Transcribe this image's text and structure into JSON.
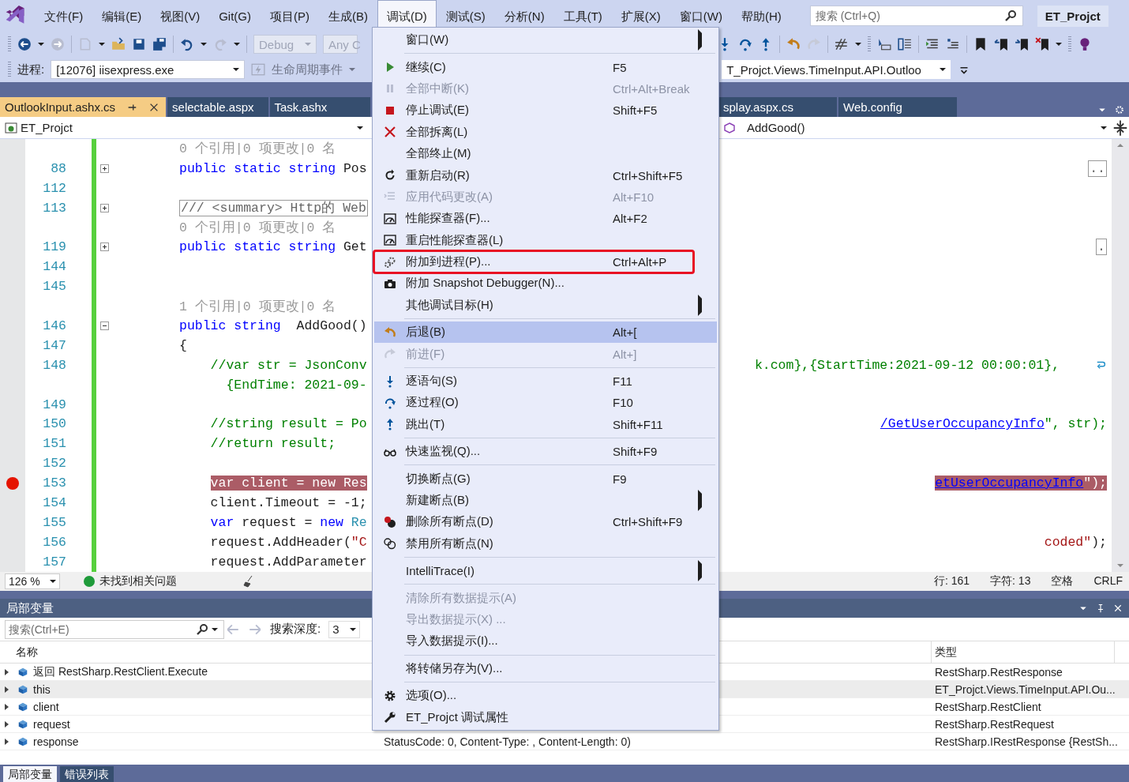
{
  "menubar": {
    "items": [
      {
        "label": "文件(F)",
        "selected": false
      },
      {
        "label": "编辑(E)",
        "selected": false
      },
      {
        "label": "视图(V)",
        "selected": false
      },
      {
        "label": "Git(G)",
        "selected": false
      },
      {
        "label": "项目(P)",
        "selected": false
      },
      {
        "label": "生成(B)",
        "selected": false
      },
      {
        "label": "调试(D)",
        "selected": true
      },
      {
        "label": "测试(S)",
        "selected": false
      },
      {
        "label": "分析(N)",
        "selected": false
      },
      {
        "label": "工具(T)",
        "selected": false
      },
      {
        "label": "扩展(X)",
        "selected": false
      },
      {
        "label": "窗口(W)",
        "selected": false
      },
      {
        "label": "帮助(H)",
        "selected": false
      }
    ],
    "search": {
      "placeholder": "搜索 (Ctrl+Q)"
    },
    "project": "ET_Projct"
  },
  "toolbar": {
    "configuration": "Debug",
    "platform": "Any C",
    "process_label": "进程:",
    "process": "[12076] iisexpress.exe",
    "lifecycle": "生命周期事件",
    "stack_frame": "T_Projct.Views.TimeInput.API.Outloo"
  },
  "doc_tabs": {
    "left": [
      {
        "label": "OutlookInput.ashx.cs",
        "selected": true
      },
      {
        "label": "selectable.aspx",
        "selected": false
      },
      {
        "label": "Task.ashx",
        "selected": false
      }
    ],
    "right": [
      {
        "label": "splay.aspx.cs",
        "selected": false
      },
      {
        "label": "Web.config",
        "selected": false
      }
    ]
  },
  "nav": {
    "project": "ET_Projct",
    "member": "AddGood()"
  },
  "editor": {
    "lines": [
      {
        "left": [
          {
            "text": "0 个引用|0 项更改|0 名",
            "kind": "lens"
          }
        ]
      },
      {
        "number": "88",
        "collapsed": true,
        "left": [
          {
            "text": "public static string ",
            "kind": "keyword"
          },
          {
            "text": "Pos",
            "kind": "plain"
          }
        ],
        "right": [
          {
            "text": "..",
            "kind": "collapsed"
          }
        ]
      },
      {
        "number": "112"
      },
      {
        "number": "113",
        "collapsed": true,
        "left": [
          {
            "text": "/// <summary> Http的 Web",
            "kind": "collapsed"
          }
        ]
      },
      {
        "left": [
          {
            "text": "0 个引用|0 项更改|0 名",
            "kind": "lens"
          }
        ]
      },
      {
        "number": "119",
        "collapsed": true,
        "left": [
          {
            "text": "public static string ",
            "kind": "keyword"
          },
          {
            "text": "Get",
            "kind": "plain"
          }
        ],
        "right": [
          {
            "text": ".",
            "kind": "collapsed"
          }
        ]
      },
      {
        "number": "144"
      },
      {
        "number": "145"
      },
      {
        "left": [
          {
            "text": "1 个引用|0 项更改|0 名",
            "kind": "lens"
          }
        ]
      },
      {
        "number": "146",
        "collapsed": false,
        "left": [
          {
            "text": "public string ",
            "kind": "keyword"
          },
          {
            "text": " AddGood()",
            "kind": "plain"
          }
        ]
      },
      {
        "number": "147",
        "left": [
          {
            "text": "{",
            "kind": "plain"
          }
        ]
      },
      {
        "number": "148",
        "wrapped": true,
        "left": [
          {
            "text": "    //var str = JsonConv",
            "kind": "comment"
          }
        ],
        "right": [
          {
            "text": "k.com},{StartTime:2021-09-12 00:00:01},",
            "kind": "comment"
          }
        ]
      },
      {
        "left": [
          {
            "text": "      {EndTime: 2021-09-",
            "kind": "comment"
          }
        ]
      },
      {
        "number": "149"
      },
      {
        "number": "150",
        "left": [
          {
            "text": "    //string result = Po",
            "kind": "comment"
          }
        ],
        "right": [
          {
            "text": "/GetUserOccupancyInfo",
            "kind": "link"
          },
          {
            "text": "\", str);",
            "kind": "comment"
          }
        ]
      },
      {
        "number": "151",
        "left": [
          {
            "text": "    //return result;",
            "kind": "comment"
          }
        ]
      },
      {
        "number": "152"
      },
      {
        "number": "153",
        "breakpoint": true,
        "left": [
          {
            "text": "    var client = new Res",
            "kind": "plain"
          }
        ],
        "right": [
          {
            "text": "etUserOccupancyInfo",
            "kind": "link"
          },
          {
            "text": "\");",
            "kind": "plain"
          }
        ]
      },
      {
        "number": "154",
        "left": [
          {
            "text": "    client.Timeout = -1;",
            "kind": "plain"
          }
        ]
      },
      {
        "number": "155",
        "left": [
          {
            "text": "    var ",
            "kind": "keyword"
          },
          {
            "text": "request = ",
            "kind": "plain"
          },
          {
            "text": "new ",
            "kind": "keyword"
          },
          {
            "text": "Re",
            "kind": "type"
          }
        ]
      },
      {
        "number": "156",
        "left": [
          {
            "text": "    request.AddHeader(",
            "kind": "plain"
          },
          {
            "text": "\"C",
            "kind": "string"
          }
        ],
        "right": [
          {
            "text": "coded\"",
            "kind": "string"
          },
          {
            "text": ");",
            "kind": "plain"
          }
        ]
      },
      {
        "number": "157",
        "left": [
          {
            "text": "    request.AddParameter",
            "kind": "plain"
          }
        ]
      }
    ]
  },
  "status": {
    "zoom": "126 %",
    "issues": "未找到相关问题",
    "line": "行: 161",
    "char": "字符: 13",
    "spaces": "空格",
    "eol": "CRLF"
  },
  "menu": {
    "groups": [
      [
        {
          "label": "窗口(W)",
          "submenu": true,
          "disabled": false,
          "selected": false
        }
      ],
      [
        {
          "label": "继续(C)",
          "shortcut": "F5",
          "disabled": false,
          "selected": false
        },
        {
          "label": "全部中断(K)",
          "shortcut": "Ctrl+Alt+Break",
          "disabled": true,
          "selected": false
        },
        {
          "label": "停止调试(E)",
          "shortcut": "Shift+F5",
          "disabled": false,
          "selected": false
        },
        {
          "label": "全部拆离(L)",
          "disabled": false,
          "selected": false
        },
        {
          "label": "全部终止(M)",
          "disabled": false,
          "selected": false
        },
        {
          "label": "重新启动(R)",
          "shortcut": "Ctrl+Shift+F5",
          "disabled": false,
          "selected": false
        },
        {
          "label": "应用代码更改(A)",
          "shortcut": "Alt+F10",
          "disabled": true,
          "selected": false
        },
        {
          "label": "性能探查器(F)...",
          "shortcut": "Alt+F2",
          "disabled": false,
          "selected": false
        },
        {
          "label": "重启性能探查器(L)",
          "disabled": false,
          "selected": false
        },
        {
          "label": "附加到进程(P)...",
          "shortcut": "Ctrl+Alt+P",
          "disabled": false,
          "selected": false,
          "annotated": true
        },
        {
          "label": "附加 Snapshot Debugger(N)...",
          "disabled": false,
          "selected": false
        },
        {
          "label": "其他调试目标(H)",
          "submenu": true,
          "disabled": false,
          "selected": false
        }
      ],
      [
        {
          "label": "后退(B)",
          "shortcut": "Alt+[",
          "disabled": false,
          "selected": true
        },
        {
          "label": "前进(F)",
          "shortcut": "Alt+]",
          "disabled": true,
          "selected": false
        }
      ],
      [
        {
          "label": "逐语句(S)",
          "shortcut": "F11",
          "disabled": false,
          "selected": false
        },
        {
          "label": "逐过程(O)",
          "shortcut": "F10",
          "disabled": false,
          "selected": false
        },
        {
          "label": "跳出(T)",
          "shortcut": "Shift+F11",
          "disabled": false,
          "selected": false
        }
      ],
      [
        {
          "label": "快速监视(Q)...",
          "shortcut": "Shift+F9",
          "disabled": false,
          "selected": false
        }
      ],
      [
        {
          "label": "切换断点(G)",
          "shortcut": "F9",
          "disabled": false,
          "selected": false
        },
        {
          "label": "新建断点(B)",
          "submenu": true,
          "disabled": false,
          "selected": false
        },
        {
          "label": "删除所有断点(D)",
          "shortcut": "Ctrl+Shift+F9",
          "disabled": false,
          "selected": false
        },
        {
          "label": "禁用所有断点(N)",
          "disabled": false,
          "selected": false
        }
      ],
      [
        {
          "label": "IntelliTrace(I)",
          "submenu": true,
          "disabled": false,
          "selected": false
        }
      ],
      [
        {
          "label": "清除所有数据提示(A)",
          "disabled": true,
          "selected": false
        },
        {
          "label": "导出数据提示(X) ...",
          "disabled": true,
          "selected": false
        },
        {
          "label": "导入数据提示(I)...",
          "disabled": false,
          "selected": false
        }
      ],
      [
        {
          "label": "将转储另存为(V)...",
          "disabled": false,
          "selected": false
        }
      ],
      [
        {
          "label": "选项(O)...",
          "disabled": false,
          "selected": false
        },
        {
          "label": "ET_Projct 调试属性",
          "disabled": false,
          "selected": false
        }
      ]
    ]
  },
  "locals": {
    "title": "局部变量",
    "search": {
      "placeholder": "搜索(Ctrl+E)"
    },
    "depth_label": "搜索深度:",
    "depth": "3",
    "columns": [
      "名称",
      "类型"
    ],
    "rows": [
      {
        "name": "返回 RestSharp.RestClient.Execute",
        "type": "RestSharp.RestResponse",
        "selected": false
      },
      {
        "name": "this",
        "type": "ET_Projct.Views.TimeInput.API.Ou...",
        "selected": true
      },
      {
        "name": "client",
        "type": "RestSharp.RestClient",
        "selected": false
      },
      {
        "name": "request",
        "type": "RestSharp.RestRequest",
        "selected": false
      },
      {
        "name": "response",
        "value": "StatusCode: 0, Content-Type: , Content-Length: 0)",
        "type": "RestSharp.IRestResponse {RestSh...",
        "selected": false
      }
    ]
  },
  "bottom_tabs": [
    {
      "label": "局部变量",
      "selected": true
    },
    {
      "label": "错误列表",
      "selected": false
    }
  ]
}
